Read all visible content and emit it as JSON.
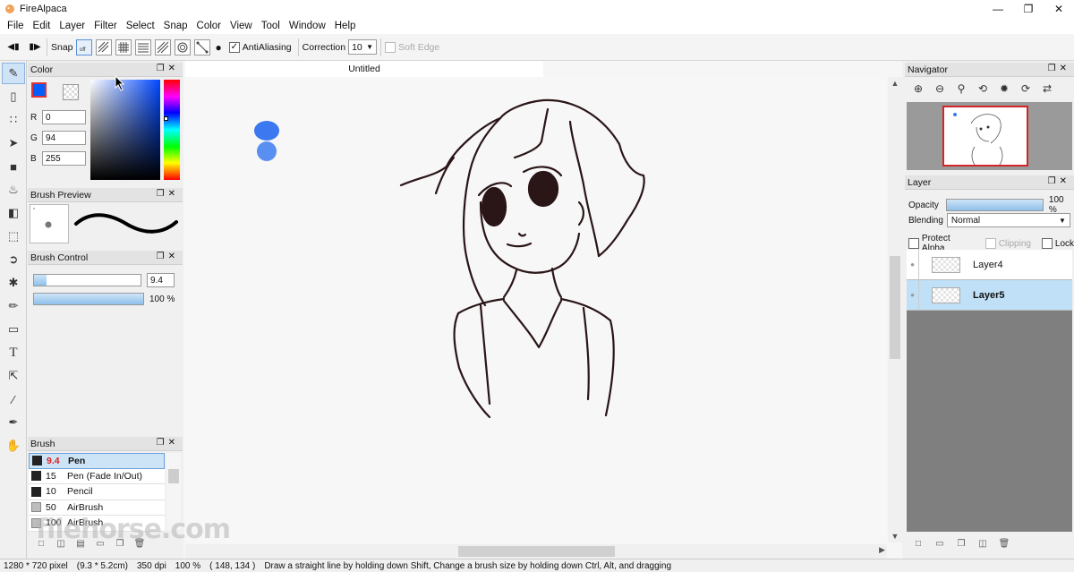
{
  "window": {
    "title": "FireAlpaca"
  },
  "menu": [
    "File",
    "Edit",
    "Layer",
    "Filter",
    "Select",
    "Snap",
    "Color",
    "View",
    "Tool",
    "Window",
    "Help"
  ],
  "toolbar": {
    "snap_label": "Snap",
    "antialiasing_label": "AntiAliasing",
    "antialiasing_checked": true,
    "correction_label": "Correction",
    "correction_value": "10",
    "soft_edge_label": "Soft Edge",
    "soft_edge_checked": false
  },
  "color_panel": {
    "title": "Color",
    "r_label": "R",
    "r": "0",
    "g_label": "G",
    "g": "94",
    "b_label": "B",
    "b": "255",
    "current_color": "#005eff"
  },
  "brush_preview": {
    "title": "Brush Preview"
  },
  "brush_control": {
    "title": "Brush Control",
    "size": "9.4",
    "size_fraction": 0.12,
    "opacity": "100 %"
  },
  "brush": {
    "title": "Brush",
    "items": [
      {
        "size": "9.4",
        "name": "Pen",
        "selected": true
      },
      {
        "size": "15",
        "name": "Pen (Fade In/Out)"
      },
      {
        "size": "10",
        "name": "Pencil"
      },
      {
        "size": "50",
        "name": "AirBrush"
      },
      {
        "size": "100",
        "name": "AirBrush"
      }
    ]
  },
  "document": {
    "tab_title": "Untitled"
  },
  "navigator": {
    "title": "Navigator"
  },
  "layer_panel": {
    "title": "Layer",
    "opacity_label": "Opacity",
    "opacity": "100 %",
    "blending_label": "Blending",
    "blending": "Normal",
    "protect_alpha": "Protect Alpha",
    "clipping": "Clipping",
    "lock": "Lock",
    "layers": [
      {
        "name": "Layer4",
        "selected": false
      },
      {
        "name": "Layer5",
        "selected": true
      }
    ]
  },
  "status": {
    "size": "1280 * 720 pixel",
    "cm": "(9.3 * 5.2cm)",
    "dpi": "350 dpi",
    "zoom": "100 %",
    "cursor": "( 148, 134 )",
    "hint": "Draw a straight line by holding down Shift, Change a brush size by holding down Ctrl, Alt, and dragging"
  },
  "watermark": "filehorse.com"
}
